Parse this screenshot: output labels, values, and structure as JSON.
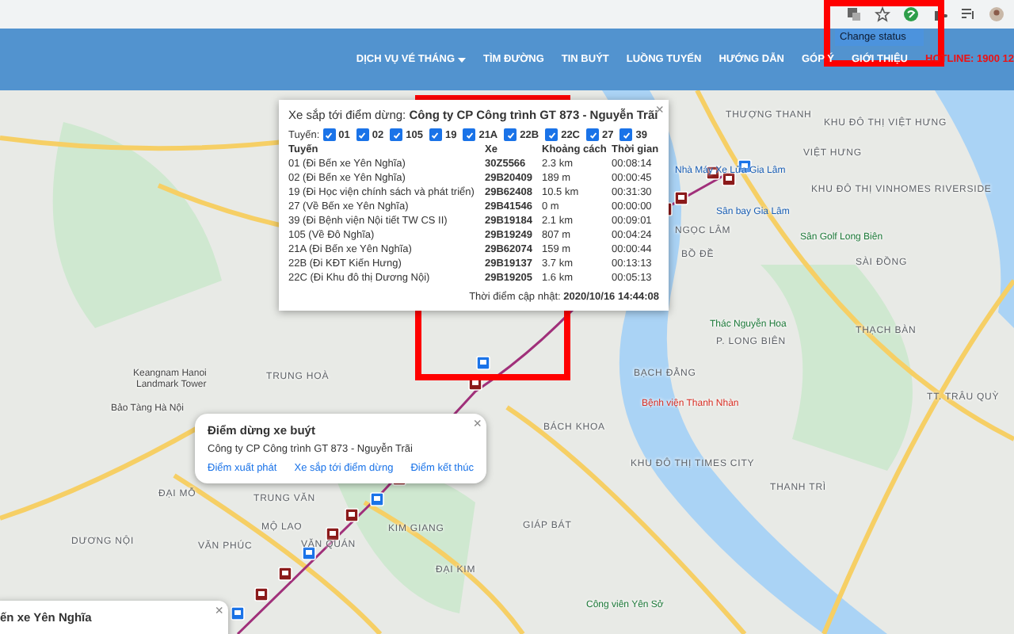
{
  "browser": {
    "menu_item": "Change status"
  },
  "nav": {
    "items": [
      {
        "label": "DỊCH VỤ VÉ THÁNG",
        "kind": "dropdown"
      },
      {
        "label": "TÌM ĐƯỜNG",
        "kind": "link"
      },
      {
        "label": "TIN BUÝT",
        "kind": "link"
      },
      {
        "label": "LUỒNG TUYẾN",
        "kind": "link"
      },
      {
        "label": "HƯỚNG DẪN",
        "kind": "link"
      },
      {
        "label": "GÓP Ý",
        "kind": "link"
      },
      {
        "label": "GIỚI THIỆU",
        "kind": "link"
      },
      {
        "label": "HOTLINE: 1900 12",
        "kind": "hotline"
      }
    ]
  },
  "map": {
    "labels": [
      {
        "text": "Keangnam Hanoi",
        "kind": "poi"
      },
      {
        "text": "Landmark Tower",
        "kind": "poi"
      },
      {
        "text": "Bảo Tàng Hà Nội",
        "kind": "poi"
      },
      {
        "text": "TRUNG HOÀ",
        "kind": "area"
      },
      {
        "text": "BÁCH KHOA",
        "kind": "area"
      },
      {
        "text": "TRUNG VĂN",
        "kind": "area"
      },
      {
        "text": "ĐẠI MỖ",
        "kind": "area"
      },
      {
        "text": "MỘ LAO",
        "kind": "area"
      },
      {
        "text": "VĂN PHÚC",
        "kind": "area"
      },
      {
        "text": "DƯƠNG NỘI",
        "kind": "area"
      },
      {
        "text": "VĂN QUÁN",
        "kind": "area"
      },
      {
        "text": "KIM GIANG",
        "kind": "area"
      },
      {
        "text": "ĐẠI KIM",
        "kind": "area"
      },
      {
        "text": "GIÁP BÁT",
        "kind": "area"
      },
      {
        "text": "THƯỢNG THANH",
        "kind": "area"
      },
      {
        "text": "KHU ĐÔ THỊ VIỆT HƯNG",
        "kind": "area"
      },
      {
        "text": "VIỆT HƯNG",
        "kind": "area"
      },
      {
        "text": "Nhà Máy Xe Lửa Gia Lâm",
        "kind": "transit"
      },
      {
        "text": "Sân bay Gia Lâm",
        "kind": "transit"
      },
      {
        "text": "NGỌC LÂM",
        "kind": "area"
      },
      {
        "text": "KHU ĐÔ THỊ VINHOMES RIVERSIDE",
        "kind": "area"
      },
      {
        "text": "Sân Golf Long Biên",
        "kind": "park"
      },
      {
        "text": "BỒ ĐỀ",
        "kind": "area"
      },
      {
        "text": "SÀI ĐỒNG",
        "kind": "area"
      },
      {
        "text": "Thác Nguyễn Hoa",
        "kind": "park"
      },
      {
        "text": "P. LONG BIÊN",
        "kind": "area"
      },
      {
        "text": "THẠCH BÀN",
        "kind": "area"
      },
      {
        "text": "BẠCH ĐẰNG",
        "kind": "area"
      },
      {
        "text": "Bệnh viện Thanh Nhàn",
        "kind": "hospital"
      },
      {
        "text": "TT. TRÂU QUỲ",
        "kind": "area"
      },
      {
        "text": "KHU ĐÔ THỊ TIMES CITY",
        "kind": "area"
      },
      {
        "text": "THANH TRÌ",
        "kind": "area"
      },
      {
        "text": "Công viên Yên Sở",
        "kind": "park"
      }
    ]
  },
  "arrivals_popup": {
    "title_prefix": "Xe sắp tới điểm dừng:",
    "stop": "Công ty CP Công trình GT 873 - Nguyễn Trãi",
    "routes_label": "Tuyến:",
    "routes": [
      {
        "label": "01",
        "checked": true
      },
      {
        "label": "02",
        "checked": true
      },
      {
        "label": "105",
        "checked": true
      },
      {
        "label": "19",
        "checked": true
      },
      {
        "label": "21A",
        "checked": true
      },
      {
        "label": "22B",
        "checked": true
      },
      {
        "label": "22C",
        "checked": true
      },
      {
        "label": "27",
        "checked": true
      },
      {
        "label": "39",
        "checked": true
      }
    ],
    "columns": [
      "Tuyến",
      "Xe",
      "Khoảng cách",
      "Thời gian"
    ],
    "rows": [
      {
        "route": "01 (Đi Bến xe Yên Nghĩa)",
        "vehicle": "30Z5566",
        "distance": "2.3 km",
        "time": "00:08:14"
      },
      {
        "route": "02 (Đi Bến xe Yên Nghĩa)",
        "vehicle": "29B20409",
        "distance": "189 m",
        "time": "00:00:45"
      },
      {
        "route": "19 (Đi Học viện chính sách và phát triển)",
        "vehicle": "29B62408",
        "distance": "10.5 km",
        "time": "00:31:30"
      },
      {
        "route": "27 (Về Bến xe Yên Nghĩa)",
        "vehicle": "29B41546",
        "distance": "0 m",
        "time": "00:00:00"
      },
      {
        "route": "39 (Đi Bệnh viện Nội tiết TW CS II)",
        "vehicle": "29B19184",
        "distance": "2.1 km",
        "time": "00:09:01"
      },
      {
        "route": "105 (Về Đô Nghĩa)",
        "vehicle": "29B19249",
        "distance": "807 m",
        "time": "00:04:24"
      },
      {
        "route": "21A (Đi Bến xe Yên Nghĩa)",
        "vehicle": "29B62074",
        "distance": "159 m",
        "time": "00:00:44"
      },
      {
        "route": "22B (Đi KĐT Kiến Hưng)",
        "vehicle": "29B19137",
        "distance": "3.7 km",
        "time": "00:13:13"
      },
      {
        "route": "22C (Đi Khu đô thị Dương Nội)",
        "vehicle": "29B19205",
        "distance": "1.6 km",
        "time": "00:05:13"
      }
    ],
    "updated_label": "Thời điểm cập nhật:",
    "updated_time": "2020/10/16 14:44:08",
    "close": "×"
  },
  "stop_popup": {
    "title": "Điểm dừng xe buýt",
    "stop": "Công ty CP Công trình GT 873 - Nguyễn Trãi",
    "links": [
      "Điểm xuất phát",
      "Xe sắp tới điểm dừng",
      "Điểm kết thúc"
    ],
    "close": "×"
  },
  "corner_popup": {
    "title": "ến xe Yên Nghĩa",
    "close": "×"
  }
}
